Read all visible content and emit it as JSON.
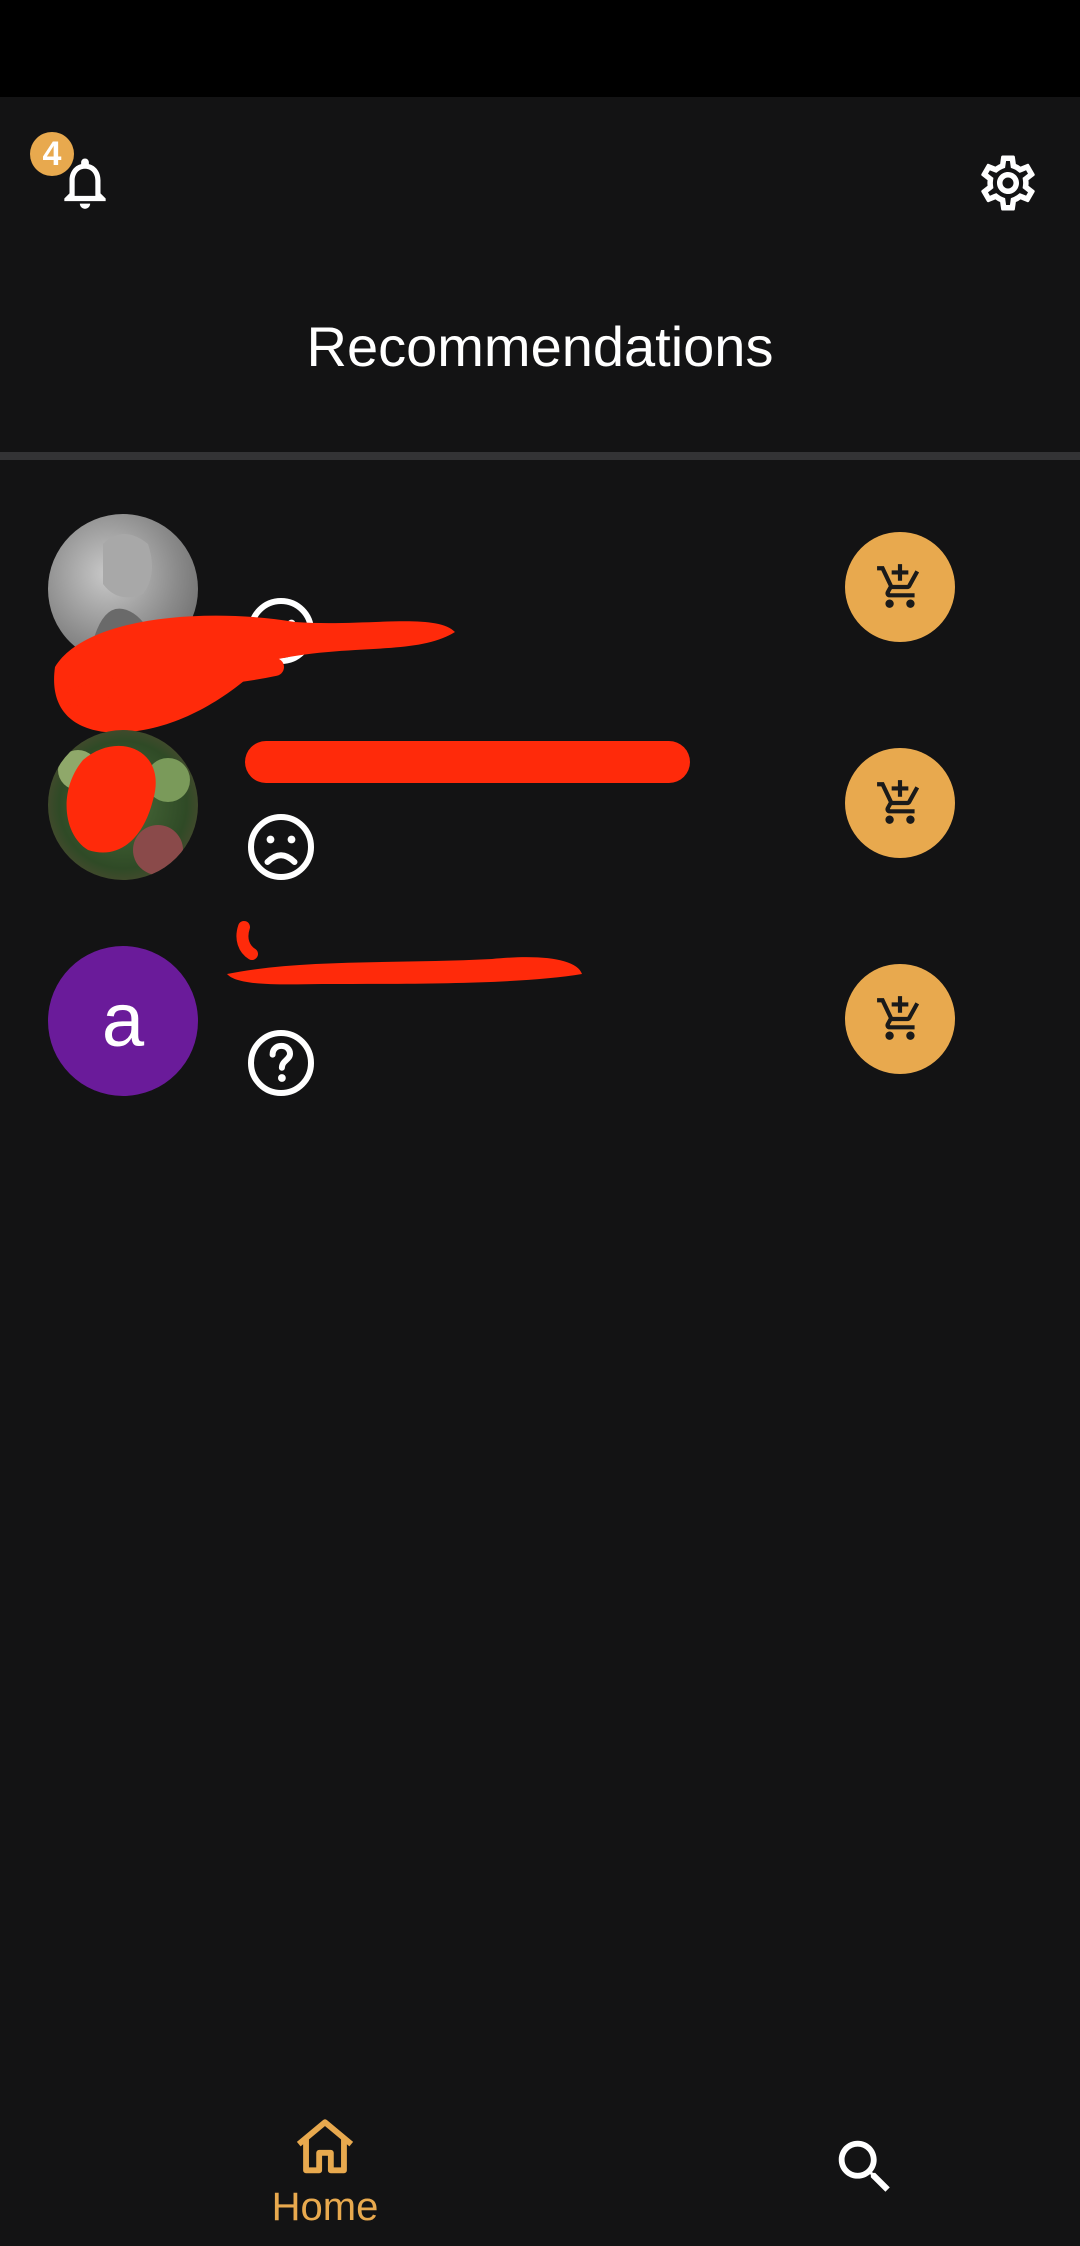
{
  "header": {
    "title": "Recommendations",
    "notification_icon": "bell-icon",
    "notification_count": "4",
    "settings_icon": "gear-icon"
  },
  "recommendations": [
    {
      "avatar": "photo",
      "name": "",
      "mood_icon": "smile-icon",
      "action_icon": "add-to-cart-icon"
    },
    {
      "avatar": "photo",
      "name": "",
      "mood_icon": "frown-icon",
      "action_icon": "add-to-cart-icon"
    },
    {
      "avatar_letter": "a",
      "avatar_color": "#6a1b9a",
      "name": "",
      "mood_icon": "question-icon",
      "action_icon": "add-to-cart-icon"
    }
  ],
  "bottom_nav": {
    "home_label": "Home",
    "home_icon": "home-icon",
    "search_icon": "search-icon"
  },
  "colors": {
    "accent": "#e8a94e",
    "background": "#131314",
    "redaction": "#ff2a0a"
  }
}
